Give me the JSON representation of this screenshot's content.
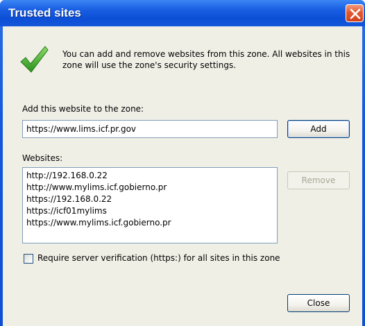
{
  "window": {
    "title": "Trusted sites",
    "close_icon": "close-icon"
  },
  "intro": {
    "icon": "checkmark-icon",
    "text": "You can add and remove websites from this zone. All websites in this zone will use the zone's security settings."
  },
  "add_section": {
    "label": "Add this website to the zone:",
    "input_value": "https://www.lims.icf.pr.gov",
    "add_label": "Add"
  },
  "websites": {
    "label": "Websites:",
    "items": [
      "http://192.168.0.22",
      "http://www.mylims.icf.gobierno.pr",
      "https://192.168.0.22",
      "https://icf01mylims",
      "https://www.mylims.icf.gobierno.pr"
    ],
    "remove_label": "Remove"
  },
  "verification": {
    "label": "Require server verification (https:) for all sites in this zone",
    "checked": false
  },
  "footer": {
    "close_label": "Close"
  },
  "colors": {
    "titlebar": "#0c4fd6",
    "client_bg": "#f0efe6",
    "close_button": "#e5582f",
    "check_green": "#3fae2a"
  }
}
